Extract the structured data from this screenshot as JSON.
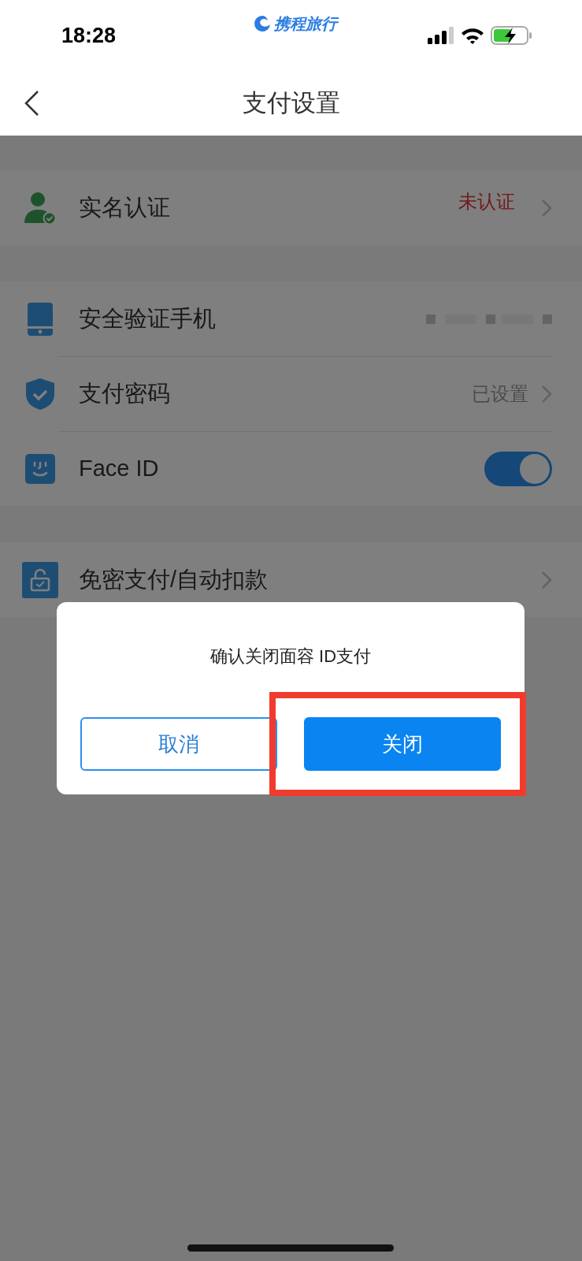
{
  "status_bar": {
    "time": "18:28",
    "app_name": "携程旅行"
  },
  "header": {
    "title": "支付设置"
  },
  "groups": [
    {
      "rows": [
        {
          "kind": "link",
          "label": "实名认证",
          "value": "未认证",
          "value_alert": true
        }
      ]
    },
    {
      "rows": [
        {
          "kind": "masked",
          "label": "安全验证手机"
        },
        {
          "kind": "link",
          "label": "支付密码",
          "value": "已设置",
          "value_alert": false
        },
        {
          "kind": "toggle",
          "label": "Face ID",
          "on": true
        }
      ]
    },
    {
      "rows": [
        {
          "kind": "link",
          "label": "免密支付/自动扣款"
        }
      ]
    }
  ],
  "dialog": {
    "message": "确认关闭面容 ID支付",
    "buttons": [
      {
        "label": "取消",
        "kind": "secondary",
        "highlighted": false
      },
      {
        "label": "关闭",
        "kind": "primary",
        "highlighted": true
      }
    ]
  }
}
